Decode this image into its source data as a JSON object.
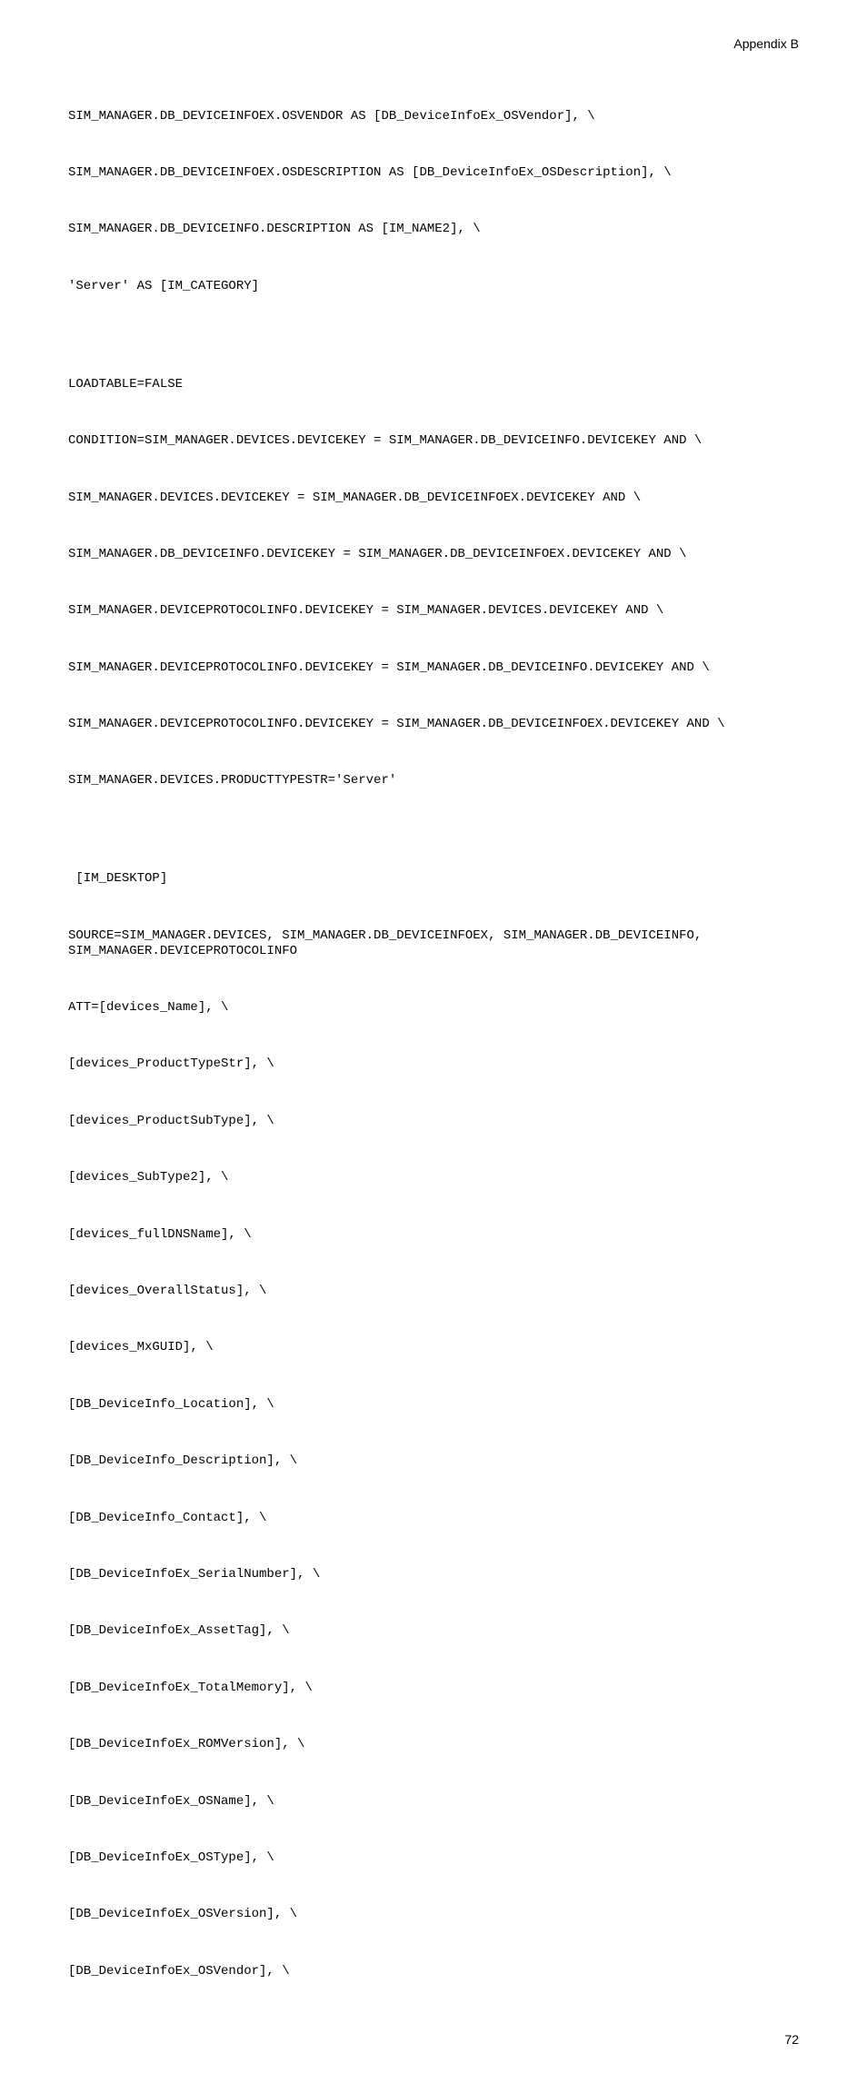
{
  "header": "Appendix B",
  "pageNumber": "72",
  "lines": [
    "SIM_MANAGER.DB_DEVICEINFOEX.OSVENDOR AS [DB_DeviceInfoEx_OSVendor], \\",
    "SIM_MANAGER.DB_DEVICEINFOEX.OSDESCRIPTION AS [DB_DeviceInfoEx_OSDescription], \\",
    "SIM_MANAGER.DB_DEVICEINFO.DESCRIPTION AS [IM_NAME2], \\",
    "'Server' AS [IM_CATEGORY]",
    "",
    "LOADTABLE=FALSE",
    "CONDITION=SIM_MANAGER.DEVICES.DEVICEKEY = SIM_MANAGER.DB_DEVICEINFO.DEVICEKEY AND \\",
    "SIM_MANAGER.DEVICES.DEVICEKEY = SIM_MANAGER.DB_DEVICEINFOEX.DEVICEKEY AND \\",
    "SIM_MANAGER.DB_DEVICEINFO.DEVICEKEY = SIM_MANAGER.DB_DEVICEINFOEX.DEVICEKEY AND \\",
    "SIM_MANAGER.DEVICEPROTOCOLINFO.DEVICEKEY = SIM_MANAGER.DEVICES.DEVICEKEY AND \\",
    "SIM_MANAGER.DEVICEPROTOCOLINFO.DEVICEKEY = SIM_MANAGER.DB_DEVICEINFO.DEVICEKEY AND \\",
    "SIM_MANAGER.DEVICEPROTOCOLINFO.DEVICEKEY = SIM_MANAGER.DB_DEVICEINFOEX.DEVICEKEY AND \\",
    "SIM_MANAGER.DEVICES.PRODUCTTYPESTR='Server'",
    "",
    " [IM_DESKTOP]",
    "SOURCE=SIM_MANAGER.DEVICES, SIM_MANAGER.DB_DEVICEINFOEX, SIM_MANAGER.DB_DEVICEINFO, SIM_MANAGER.DEVICEPROTOCOLINFO",
    "ATT=[devices_Name], \\",
    "[devices_ProductTypeStr], \\",
    "[devices_ProductSubType], \\",
    "[devices_SubType2], \\",
    "[devices_fullDNSName], \\",
    "[devices_OverallStatus], \\",
    "[devices_MxGUID], \\",
    "[DB_DeviceInfo_Location], \\",
    "[DB_DeviceInfo_Description], \\",
    "[DB_DeviceInfo_Contact], \\",
    "[DB_DeviceInfoEx_SerialNumber], \\",
    "[DB_DeviceInfoEx_AssetTag], \\",
    "[DB_DeviceInfoEx_TotalMemory], \\",
    "[DB_DeviceInfoEx_ROMVersion], \\",
    "[DB_DeviceInfoEx_OSName], \\",
    "[DB_DeviceInfoEx_OSType], \\",
    "[DB_DeviceInfoEx_OSVersion], \\",
    "[DB_DeviceInfoEx_OSVendor], \\"
  ]
}
